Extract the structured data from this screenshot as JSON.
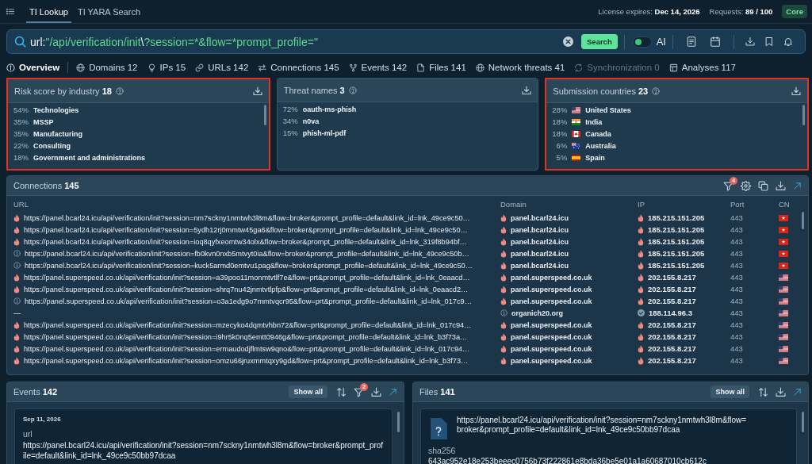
{
  "top_bar": {
    "tabs": [
      {
        "label": "TI Lookup",
        "selected": true
      },
      {
        "label": "TI YARA Search",
        "selected": false
      }
    ],
    "license": "License expires: **Dec 14, 2026**",
    "requests": "Requests: **89 / 100**",
    "plan": "Core"
  },
  "search": {
    "query": [
      {
        "kind": "field",
        "text": "url:"
      },
      {
        "kind": "string",
        "text": "\"/api/verification/init"
      },
      {
        "kind": "escape",
        "text": "\\"
      },
      {
        "kind": "string",
        "text": "?session=*&flow=*prompt_profile=\""
      }
    ],
    "button": "Search",
    "ai_toggle": {
      "label": "AI",
      "on": false
    }
  },
  "nav_tabs": [
    {
      "kind": "overview",
      "label": "Overview",
      "selected": true,
      "disabled": false
    },
    {
      "kind": "domains",
      "label": "Domains 12",
      "selected": false,
      "disabled": false
    },
    {
      "kind": "ips",
      "label": "IPs 15",
      "selected": false,
      "disabled": false
    },
    {
      "kind": "urls",
      "label": "URLs 142",
      "selected": false,
      "disabled": false
    },
    {
      "kind": "connections",
      "label": "Connections 145",
      "selected": false,
      "disabled": false
    },
    {
      "kind": "events",
      "label": "Events 142",
      "selected": false,
      "disabled": false
    },
    {
      "kind": "files",
      "label": "Files 141",
      "selected": false,
      "disabled": false
    },
    {
      "kind": "network_threats",
      "label": "Network threats 41",
      "selected": false,
      "disabled": false
    },
    {
      "kind": "synchronization",
      "label": "Synchronization 0",
      "selected": false,
      "disabled": true
    },
    {
      "kind": "analyses",
      "label": "Analyses 117",
      "selected": false,
      "disabled": false
    }
  ],
  "summary_panels": [
    {
      "title": "Risk score by industry **18**",
      "highlighted": true,
      "rows": [
        {
          "percent": "54%",
          "name": "Technologies"
        },
        {
          "percent": "35%",
          "name": "MSSP"
        },
        {
          "percent": "35%",
          "name": "Manufacturing"
        },
        {
          "percent": "22%",
          "name": "Consulting"
        },
        {
          "percent": "18%",
          "name": "Government and administrations"
        }
      ]
    },
    {
      "title": "Threat names **3**",
      "highlighted": false,
      "rows": [
        {
          "percent": "72%",
          "name": "oauth-ms-phish"
        },
        {
          "percent": "34%",
          "name": "n0va"
        },
        {
          "percent": "15%",
          "name": "phish-ml-pdf"
        }
      ]
    },
    {
      "title": "Submission countries **23**",
      "highlighted": true,
      "rows": [
        {
          "percent": "28%",
          "flag": {
            "kind": "us"
          },
          "name": "United States"
        },
        {
          "percent": "18%",
          "flag": {
            "kind": "in"
          },
          "name": "India"
        },
        {
          "percent": "18%",
          "flag": {
            "kind": "ca"
          },
          "name": "Canada"
        },
        {
          "percent": "6%",
          "flag": {
            "kind": "au"
          },
          "name": "Australia"
        },
        {
          "percent": "5%",
          "flag": {
            "kind": "es"
          },
          "name": "Spain"
        }
      ]
    }
  ],
  "connections": {
    "title": "Connections **145**",
    "filter_badge": "4",
    "columns": [
      "URL",
      "Domain",
      "IP",
      "Port",
      "CN"
    ],
    "rows": [
      {
        "url": {
          "text": "https://panel.bcarl24.icu/api/verification/init?session=nm7sckny1nmtwh3l8m&flow=broker&prompt_profile=default&link_id=lnk_49ce9c50…",
          "kind": "malicious"
        },
        "domain": {
          "text": "panel.bcarl24.icu",
          "kind": "malicious"
        },
        "ip": {
          "text": "185.215.151.205",
          "kind": "malicious"
        },
        "port": "443",
        "flag": {
          "kind": "hk"
        }
      },
      {
        "url": {
          "text": "https://panel.bcarl24.icu/api/verification/init?session=5ydh12rj0mmtw45ga6&flow=broker&prompt_profile=default&link_id=lnk_49ce9c50…",
          "kind": "malicious"
        },
        "domain": {
          "text": "panel.bcarl24.icu",
          "kind": "malicious"
        },
        "ip": {
          "text": "185.215.151.205",
          "kind": "malicious"
        },
        "port": "443",
        "flag": {
          "kind": "hk"
        }
      },
      {
        "url": {
          "text": "https://panel.bcarl24.icu/api/verification/init?session=ioq8qyfxeomtw34olx&flow=broker&prompt_profile=default&link_id=lnk_319f8b94bf…",
          "kind": "malicious"
        },
        "domain": {
          "text": "panel.bcarl24.icu",
          "kind": "malicious"
        },
        "ip": {
          "text": "185.215.151.205",
          "kind": "malicious"
        },
        "port": "443",
        "flag": {
          "kind": "hk"
        }
      },
      {
        "url": {
          "text": "https://panel.bcarl24.icu/api/verification/init?session=fb0kvn0nxb5mtvyt0ia&flow=broker&prompt_profile=default&link_id=lnk_49ce9c50b…",
          "kind": "unknown"
        },
        "domain": {
          "text": "panel.bcarl24.icu",
          "kind": "malicious"
        },
        "ip": {
          "text": "185.215.151.205",
          "kind": "malicious"
        },
        "port": "443",
        "flag": {
          "kind": "hk"
        }
      },
      {
        "url": {
          "text": "https://panel.bcarl24.icu/api/verification/init?session=kuck5armd0emtvu1pag&flow=broker&prompt_profile=default&link_id=lnk_49ce9c50…",
          "kind": "unknown"
        },
        "domain": {
          "text": "panel.bcarl24.icu",
          "kind": "malicious"
        },
        "ip": {
          "text": "185.215.151.205",
          "kind": "malicious"
        },
        "port": "443",
        "flag": {
          "kind": "hk"
        }
      },
      {
        "url": {
          "text": "https://panel.superspeed.co.uk/api/verification/init?session=a39poo11monmtvtlf7e&flow=prt&prompt_profile=default&link_id=lnk_0eaacd…",
          "kind": "malicious"
        },
        "domain": {
          "text": "panel.superspeed.co.uk",
          "kind": "malicious"
        },
        "ip": {
          "text": "202.155.8.217",
          "kind": "malicious"
        },
        "port": "443",
        "flag": {
          "kind": "us"
        }
      },
      {
        "url": {
          "text": "https://panel.superspeed.co.uk/api/verification/init?session=shrq7nu42jnmtvtlpfp&flow=prt&prompt_profile=default&link_id=lnk_0eaacd2…",
          "kind": "malicious"
        },
        "domain": {
          "text": "panel.superspeed.co.uk",
          "kind": "malicious"
        },
        "ip": {
          "text": "202.155.8.217",
          "kind": "malicious"
        },
        "port": "443",
        "flag": {
          "kind": "us"
        }
      },
      {
        "url": {
          "text": "https://panel.superspeed.co.uk/api/verification/init?session=o3a1edg9o7mmtvqcr95&flow=prt&prompt_profile=default&link_id=lnk_017c9…",
          "kind": "unknown"
        },
        "domain": {
          "text": "panel.superspeed.co.uk",
          "kind": "malicious"
        },
        "ip": {
          "text": "202.155.8.217",
          "kind": "malicious"
        },
        "port": "443",
        "flag": {
          "kind": "us"
        }
      },
      {
        "url": {
          "text": "—",
          "kind": "none"
        },
        "domain": {
          "text": "organich20.org",
          "kind": "unknown"
        },
        "ip": {
          "text": "188.114.96.3",
          "kind": "clean"
        },
        "port": "443",
        "flag": {
          "kind": "us"
        }
      },
      {
        "url": {
          "text": "https://panel.superspeed.co.uk/api/verification/init?session=mzecyko4dqmtvhbn72&flow=prt&prompt_profile=default&link_id=lnk_017c94…",
          "kind": "malicious"
        },
        "domain": {
          "text": "panel.superspeed.co.uk",
          "kind": "malicious"
        },
        "ip": {
          "text": "202.155.8.217",
          "kind": "malicious"
        },
        "port": "443",
        "flag": {
          "kind": "us"
        }
      },
      {
        "url": {
          "text": "https://panel.superspeed.co.uk/api/verification/init?session=i9hr5k0nq5emtt0946g&flow=prt&prompt_profile=default&link_id=lnk_b3f73a…",
          "kind": "malicious"
        },
        "domain": {
          "text": "panel.superspeed.co.uk",
          "kind": "malicious"
        },
        "ip": {
          "text": "202.155.8.217",
          "kind": "malicious"
        },
        "port": "443",
        "flag": {
          "kind": "us"
        }
      },
      {
        "url": {
          "text": "https://panel.superspeed.co.uk/api/verification/init?session=ermaudodjflmtsw9qno&flow=prt&prompt_profile=default&link_id=lnk_017c94…",
          "kind": "malicious"
        },
        "domain": {
          "text": "panel.superspeed.co.uk",
          "kind": "malicious"
        },
        "ip": {
          "text": "202.155.8.217",
          "kind": "malicious"
        },
        "port": "443",
        "flag": {
          "kind": "us"
        }
      },
      {
        "url": {
          "text": "https://panel.superspeed.co.uk/api/verification/init?session=omzu66jruxmmtqxy9gd&flow=prt&prompt_profile=default&link_id=lnk_b3f73…",
          "kind": "malicious"
        },
        "domain": {
          "text": "panel.superspeed.co.uk",
          "kind": "malicious"
        },
        "ip": {
          "text": "202.155.8.217",
          "kind": "malicious"
        },
        "port": "443",
        "flag": {
          "kind": "us"
        }
      }
    ]
  },
  "events": {
    "title": "Events **142**",
    "show_all": "Show all",
    "filter_badge": "2",
    "card": {
      "date": "Sep 11, 2026",
      "field_label": "url",
      "value": "https://panel.bcarl24.icu/api/verification/init?session=nm7sckny1nmtwh3l8m&flow=broker&prompt_profile=default&link_id=lnk_49ce9c50bb97dcaa"
    }
  },
  "files": {
    "title": "Files **141**",
    "show_all": "Show all",
    "card": {
      "url": "https://panel.bcarl24.icu/api/verification/init?session=nm7sckny1nmtwh3l8m&flow=broker&prompt_profile=default&link_id=lnk_49ce9c50bb97dcaa",
      "hash_label": "sha256",
      "hash": "643ac952e18e253beeec0756b73f222861e8bda36be5e01a1a60687010cb612c"
    }
  }
}
